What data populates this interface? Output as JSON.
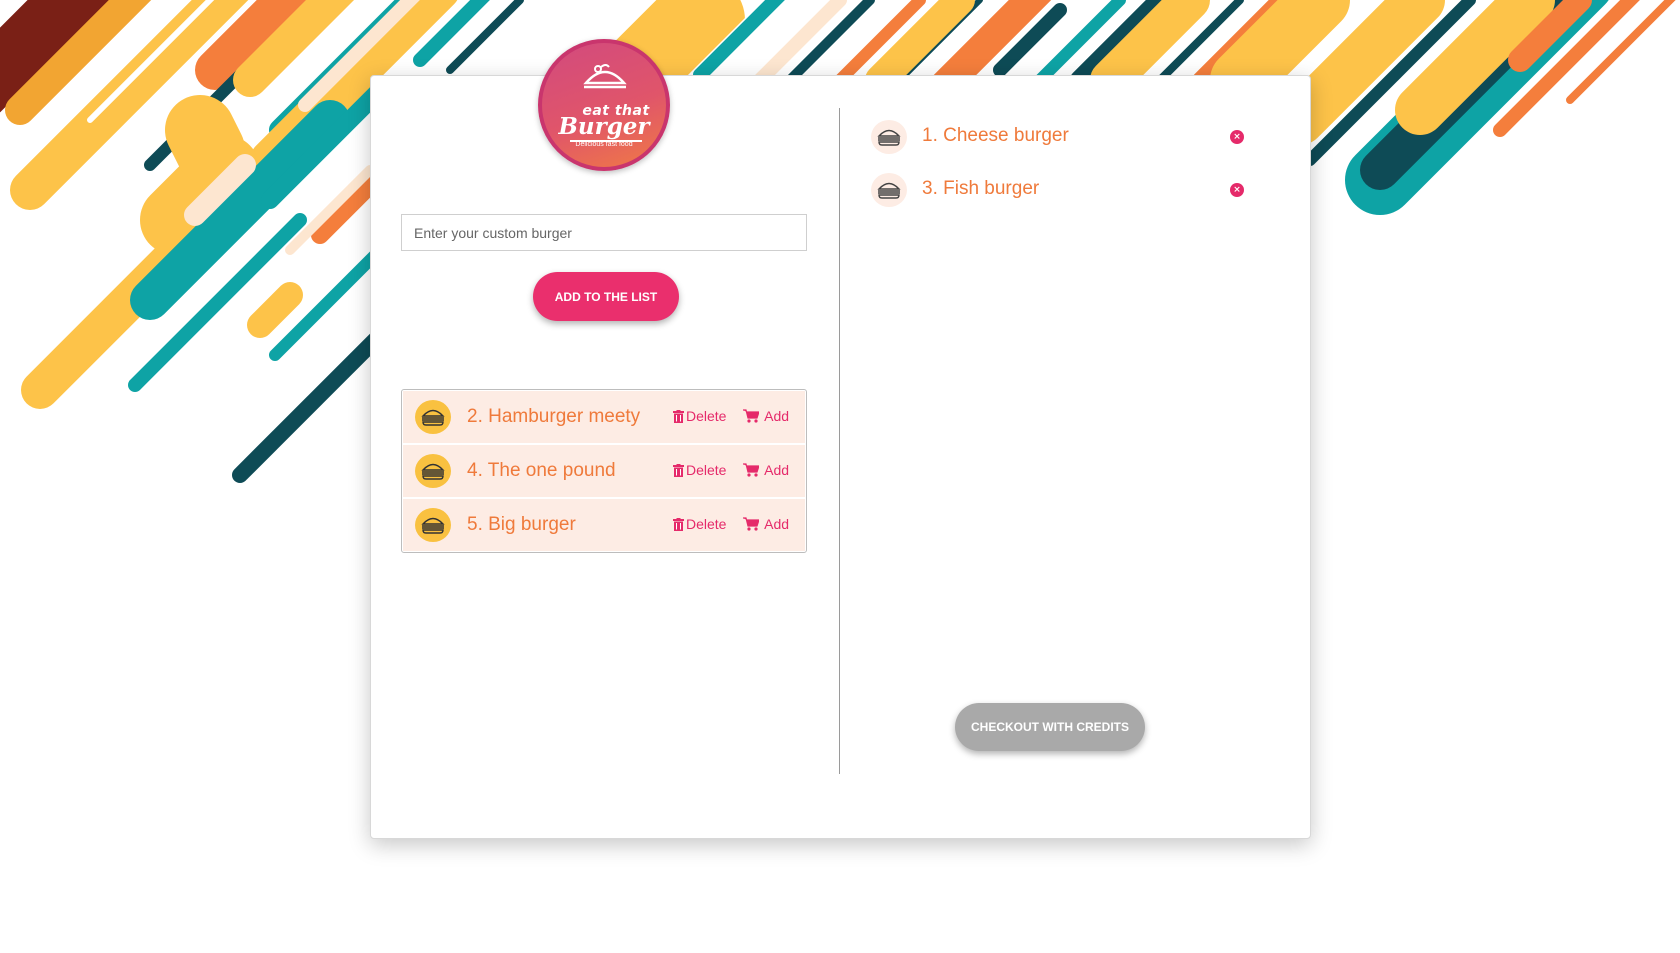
{
  "logo": {
    "line1": "eat that",
    "line2": "Burger",
    "tagline": "Delicious fast food"
  },
  "input": {
    "placeholder": "Enter your custom burger",
    "value": ""
  },
  "add_button_label": "ADD TO THE LIST",
  "todo_burgers": [
    {
      "name": "2. Hamburger meety",
      "delete_label": "Delete",
      "add_label": "Add"
    },
    {
      "name": "4. The one pound",
      "delete_label": "Delete",
      "add_label": "Add"
    },
    {
      "name": "5. Big burger",
      "delete_label": "Delete",
      "add_label": "Add"
    }
  ],
  "devoured_burgers": [
    {
      "name": "1. Cheese burger"
    },
    {
      "name": "3. Fish burger"
    }
  ],
  "checkout_label": "CHECKOUT WITH CREDITS",
  "colors": {
    "accent_pink": "#ea2f6d",
    "text_orange": "#ef7a3b",
    "row_bg": "#fdece4",
    "icon_yellow": "#f9c140",
    "disabled_gray": "#a9a9a9"
  },
  "icons": [
    "burger-icon",
    "trash-icon",
    "cart-icon",
    "close-icon"
  ]
}
